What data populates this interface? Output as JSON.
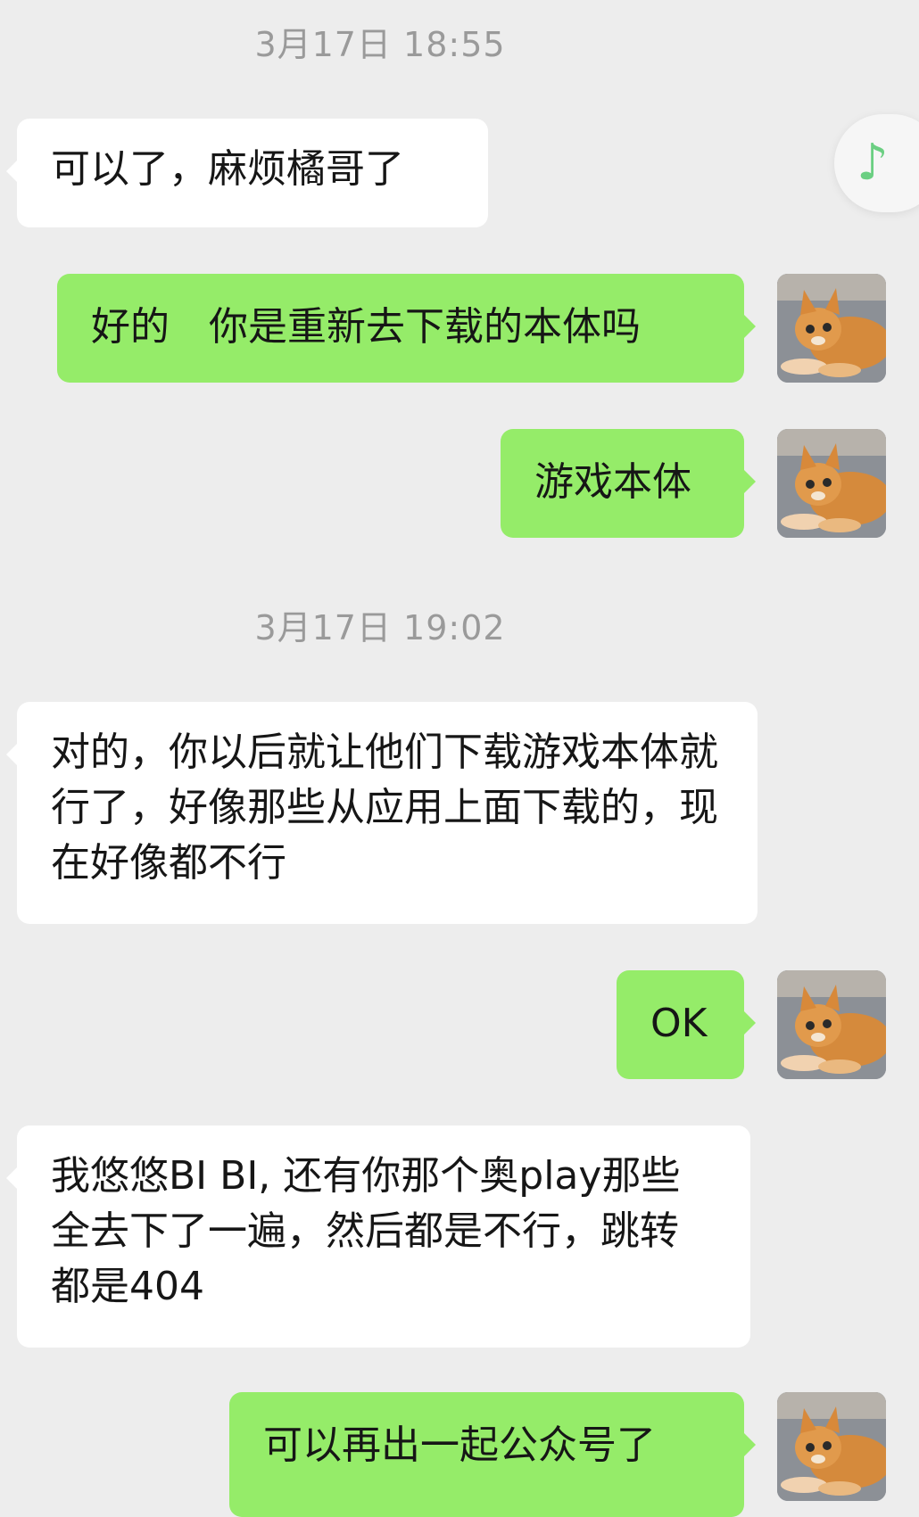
{
  "chat": {
    "timestamps": [
      "3月17日 18:55",
      "3月17日 19:02"
    ],
    "messages": [
      {
        "sender": "other",
        "text": "可以了，麻烦橘哥了"
      },
      {
        "sender": "me",
        "text": "好的　你是重新去下载的本体吗"
      },
      {
        "sender": "me",
        "text": "游戏本体"
      },
      {
        "sender": "other",
        "text": "对的，你以后就让他们下载游戏本体就行了，好像那些从应用上面下载的，现在好像都不行"
      },
      {
        "sender": "me",
        "text": "OK"
      },
      {
        "sender": "other",
        "text": "我悠悠BI BI, 还有你那个奥play那些全去下了一遍，然后都是不行，跳转都是404"
      },
      {
        "sender": "me",
        "text": "可以再出一起公众号了"
      }
    ]
  },
  "floating_widget": {
    "icon": "music-note-icon",
    "glyph": "♪"
  },
  "colors": {
    "background": "#ededed",
    "incoming": "#ffffff",
    "outgoing": "#95ec69",
    "timestamp": "#9a9a9a"
  },
  "avatar": {
    "icon": "cat-avatar"
  }
}
